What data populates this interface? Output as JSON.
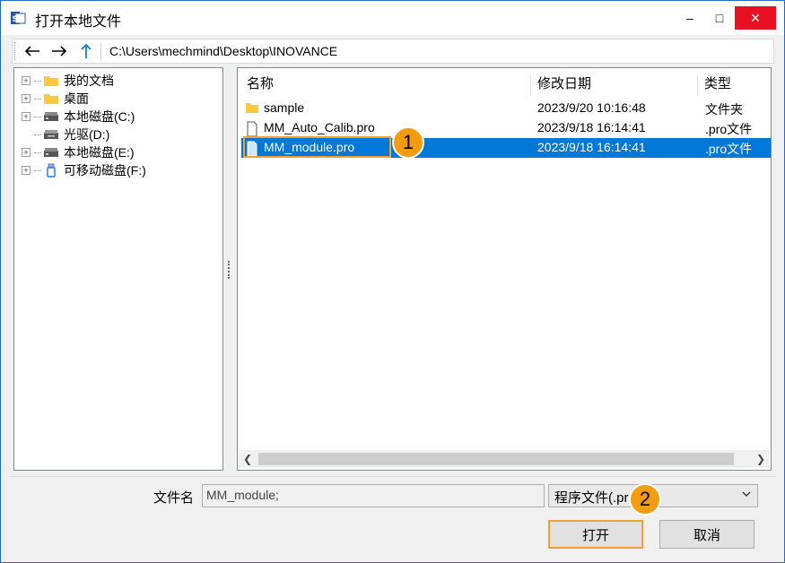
{
  "window": {
    "title": "打开本地文件",
    "controls": {
      "minimize": "–",
      "maximize": "□",
      "close": "✕"
    }
  },
  "toolbar": {
    "back_icon": "back-arrow-icon",
    "forward_icon": "forward-arrow-icon",
    "up_icon": "up-arrow-icon",
    "address": "C:\\Users\\mechmind\\Desktop\\INOVANCE"
  },
  "tree": {
    "items": [
      {
        "label": "我的文档",
        "icon": "folder-icon",
        "expandable": true
      },
      {
        "label": "桌面",
        "icon": "folder-icon",
        "expandable": true
      },
      {
        "label": "本地磁盘(C:)",
        "icon": "drive-icon",
        "expandable": true
      },
      {
        "label": "光驱(D:)",
        "icon": "optical-drive-icon",
        "expandable": false
      },
      {
        "label": "本地磁盘(E:)",
        "icon": "drive-icon",
        "expandable": true
      },
      {
        "label": "可移动磁盘(F:)",
        "icon": "usb-drive-icon",
        "expandable": true
      }
    ]
  },
  "list": {
    "columns": [
      "名称",
      "修改日期",
      "类型"
    ],
    "rows": [
      {
        "name": "sample",
        "date": "2023/9/20 10:16:48",
        "type": "文件夹",
        "icon": "folder-icon",
        "selected": false
      },
      {
        "name": "MM_Auto_Calib.pro",
        "date": "2023/9/18 16:14:41",
        "type": ".pro文件",
        "icon": "file-icon",
        "selected": false
      },
      {
        "name": "MM_module.pro",
        "date": "2023/9/18 16:14:41",
        "type": ".pro文件",
        "icon": "file-icon",
        "selected": true
      }
    ]
  },
  "bottom": {
    "filename_label": "文件名",
    "filename_value": "MM_module;",
    "filetype_value": "程序文件(.pro",
    "open_label": "打开",
    "cancel_label": "取消"
  },
  "callouts": {
    "step1": "1",
    "step2": "2"
  },
  "colors": {
    "accent": "#0078d7",
    "callout": "#f39c12",
    "close": "#e81123"
  }
}
